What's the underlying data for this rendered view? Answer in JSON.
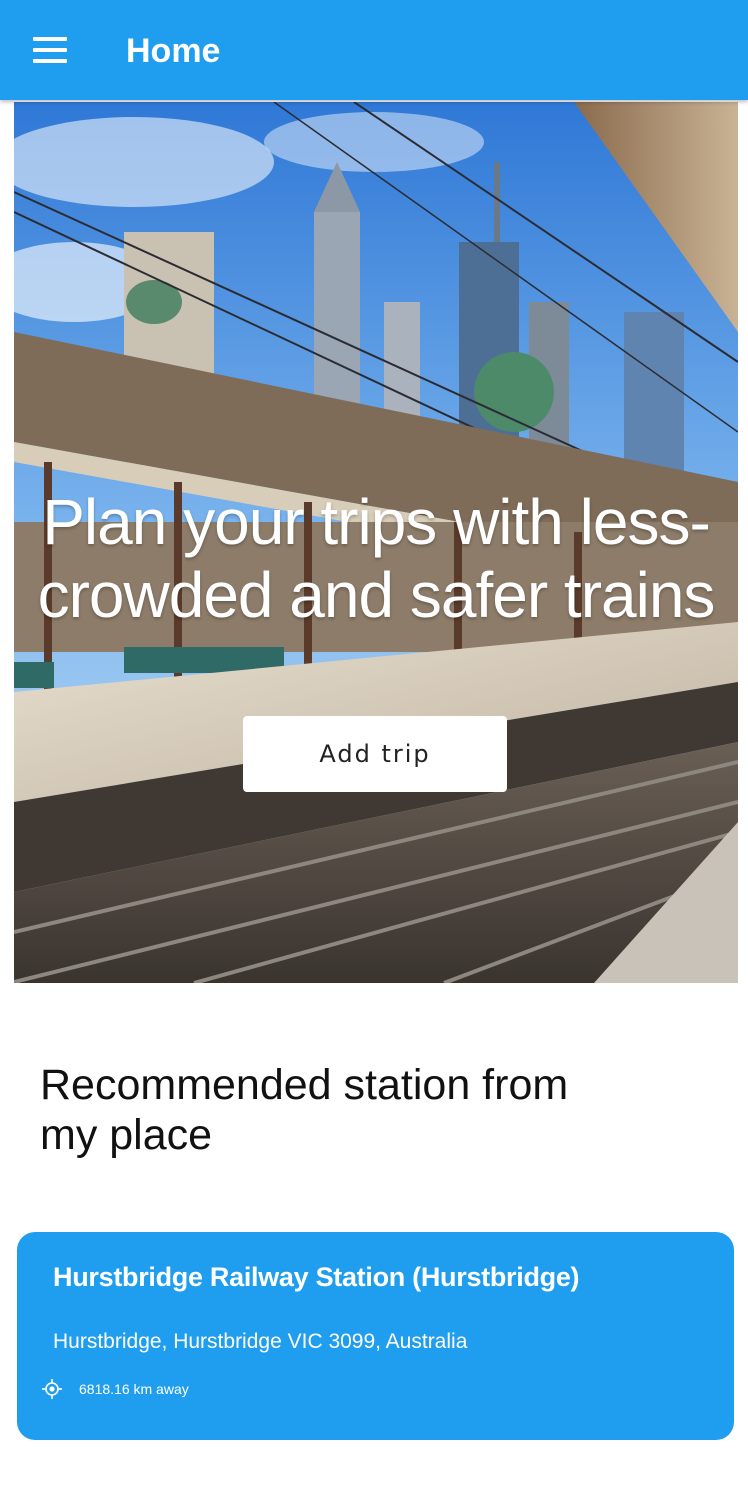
{
  "appbar": {
    "title": "Home",
    "menu_icon": "hamburger-menu-icon",
    "color": "#1f9eef"
  },
  "hero": {
    "headline": "Plan your trips with less-crowded and safer trains",
    "button_label": "Add trip"
  },
  "recommended": {
    "section_title": "Recommended station from my place",
    "station": {
      "name": "Hurstbridge Railway Station (Hurstbridge)",
      "address": "Hurstbridge, Hurstbridge VIC 3099, Australia",
      "distance": "6818.16 km away",
      "distance_icon": "location-target-icon"
    }
  }
}
